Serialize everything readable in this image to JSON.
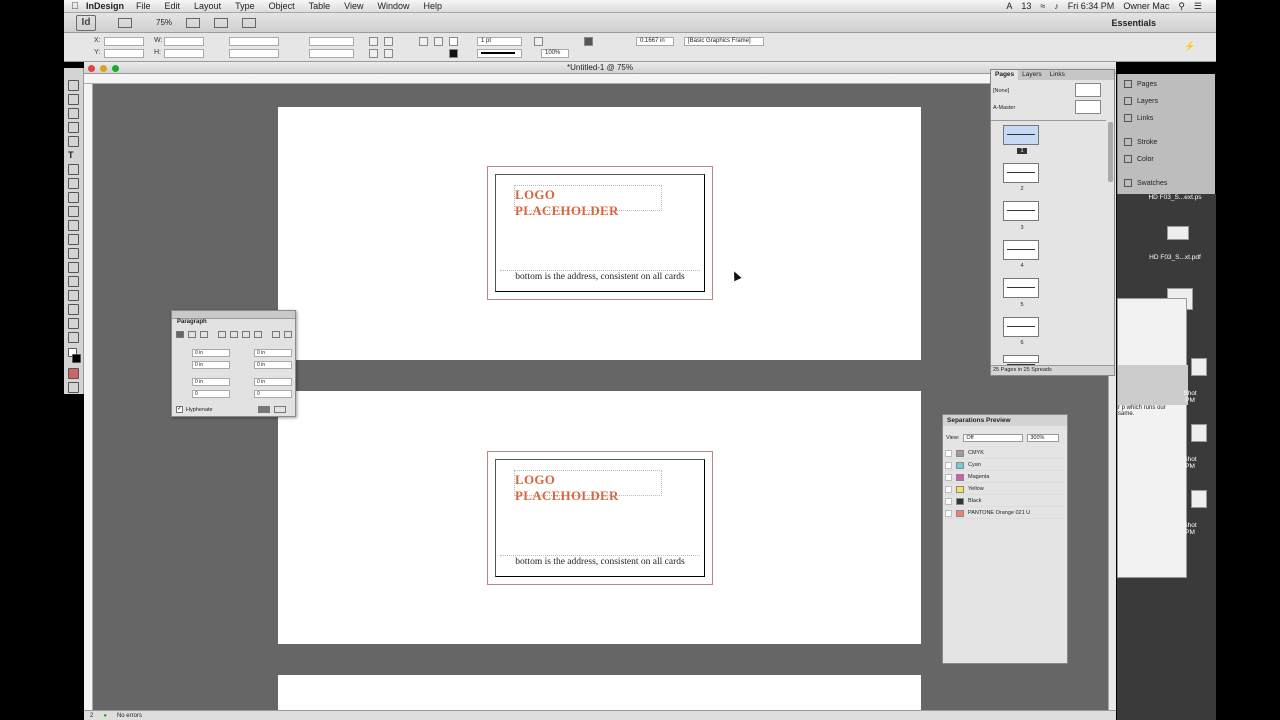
{
  "menubar": {
    "app": "InDesign",
    "items": [
      "File",
      "Edit",
      "Layout",
      "Type",
      "Object",
      "Table",
      "View",
      "Window",
      "Help"
    ],
    "clock": "Fri 6:34 PM",
    "user": "Owner Mac",
    "battery_hint": "13"
  },
  "appbar": {
    "logo": "Id",
    "zoom": "75%",
    "workspace": "Essentials"
  },
  "control": {
    "x_label": "X:",
    "y_label": "Y:",
    "w_label": "W:",
    "h_label": "H:",
    "stroke_weight": "1 pt",
    "percent": "100%",
    "offset": "0.1667 in",
    "object_style": "[Basic Graphics Frame]"
  },
  "document": {
    "title": "*Untitled-1 @ 75%",
    "cards": [
      {
        "logo": "LOGO PLACEHOLDER",
        "address": "bottom is the address, consistent on all cards"
      },
      {
        "logo": "LOGO PLACEHOLDER",
        "address": "bottom is the address, consistent on all cards"
      }
    ],
    "status": {
      "page": "2",
      "errors": "No errors"
    }
  },
  "paragraph_panel": {
    "title": "Paragraph",
    "left_indent": "0 in",
    "right_indent": "0 in",
    "first_line": "0 in",
    "last_line": "0 in",
    "space_before": "0 in",
    "space_after": "0 in",
    "drop_lines": "0",
    "drop_chars": "0",
    "hyphenate": "Hyphenate"
  },
  "pages_panel": {
    "tabs": [
      "Pages",
      "Layers",
      "Links"
    ],
    "masters": [
      "[None]",
      "A-Master"
    ],
    "page_numbers": [
      "1",
      "2",
      "3",
      "4",
      "5",
      "6"
    ],
    "footer": "25 Pages in 25 Spreads"
  },
  "dock": {
    "items": [
      "Pages",
      "Layers",
      "Links",
      "Stroke",
      "Color",
      "Swatches"
    ]
  },
  "separations": {
    "title": "Separations Preview",
    "view_label": "View:",
    "view_value": "Off",
    "zoom": "300%",
    "inks": [
      {
        "name": "CMYK",
        "color": "#9a9a9a"
      },
      {
        "name": "Cyan",
        "color": "#6fc8e8"
      },
      {
        "name": "Magenta",
        "color": "#d25ca8"
      },
      {
        "name": "Yellow",
        "color": "#f2e84a"
      },
      {
        "name": "Black",
        "color": "#333333"
      },
      {
        "name": "PANTONE Orange 021 U",
        "color": "#f0826a"
      }
    ]
  },
  "desktop": {
    "files": [
      "HD F03_S...ext.ps",
      "HD F03_S...xt.pdf"
    ],
    "shots": [
      "Shot\nPM",
      "Shot\nPM",
      "Shot\nPM"
    ],
    "note": "r p which runs our\nsame."
  },
  "colors": {
    "logo": "#d8653d",
    "pasteboard": "#666666"
  }
}
